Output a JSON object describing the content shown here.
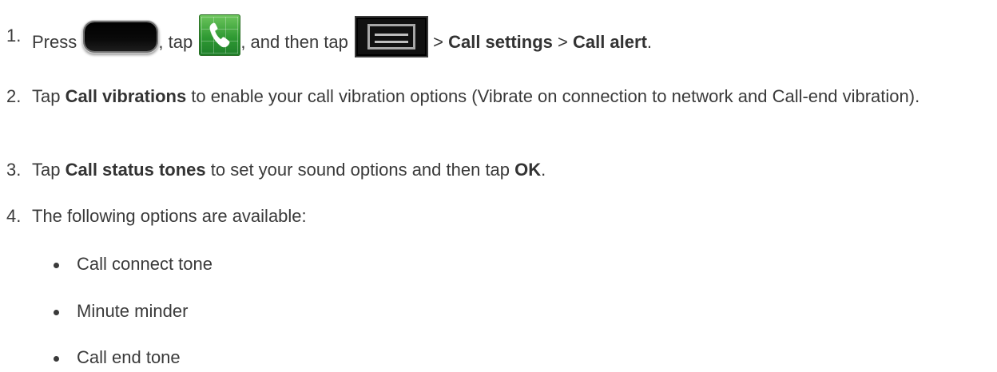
{
  "steps": [
    {
      "number": "1.",
      "parts": {
        "press": "Press",
        "tap": ", tap",
        "then": ", and then tap",
        "sep1": " > ",
        "call_settings": "Call settings",
        "sep2": " > ",
        "call_alert": "Call alert",
        "end": "."
      },
      "icons": [
        "home-key-icon",
        "phone-app-icon",
        "menu-key-icon"
      ]
    },
    {
      "number": "2.",
      "pre": "Tap ",
      "bold": "Call vibrations",
      "post": " to enable your call vibration options (Vibrate on connection to network and Call-end vibration)."
    },
    {
      "number": "3.",
      "pre": "Tap ",
      "bold": "Call status tones",
      "mid": " to set your sound options and then tap ",
      "bold2": "OK",
      "post": "."
    },
    {
      "number": "4.",
      "text": "The following options are available:"
    }
  ],
  "options": [
    "Call connect tone",
    "Minute minder",
    "Call end tone"
  ],
  "colors": {
    "text": "#3a3a3a",
    "phone_icon_green": "#2f9a33"
  }
}
